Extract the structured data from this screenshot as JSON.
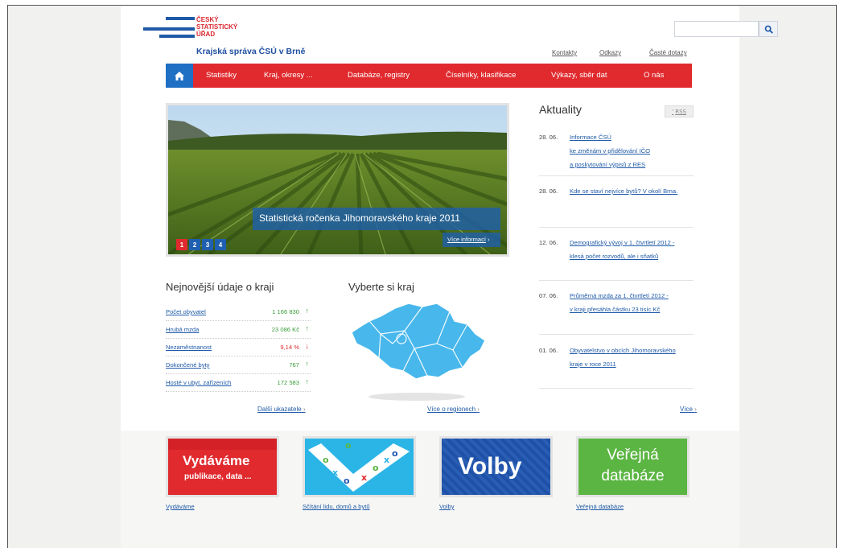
{
  "header": {
    "logo_lines": [
      "ČESKÝ",
      "STATISTICKÝ",
      "ÚŘAD"
    ],
    "subtitle": "Krajská správa ČSÚ v Brně",
    "top_links": [
      "Kontakty",
      "Odkazy",
      "Časté dotazy"
    ]
  },
  "nav": {
    "items": [
      "Statistiky",
      "Kraj, okresy ...",
      "Databáze, registry",
      "Číselníky, klasifikace",
      "Výkazy, sběr dat",
      "O nás"
    ]
  },
  "slider": {
    "caption": "Statistická ročenka Jihomoravského kraje 2011",
    "more_label": "Více informací",
    "pages": [
      "1",
      "2",
      "3",
      "4"
    ],
    "active_page": "1"
  },
  "news": {
    "title": "Aktuality",
    "rss_label": "RSS",
    "items": [
      {
        "date": "28. 06.",
        "text": "Informace ČSÚ\nke změnám v přidělování IČO\na poskytování výpisů z RES"
      },
      {
        "date": "28. 06.",
        "text": "Kde se staví nejvíce bytů? V okolí Brna."
      },
      {
        "date": "12. 06.",
        "text": "Demografický vývoj v 1. čtvrtletí 2012 -\nklesá počet rozvodů, ale i sňatků"
      },
      {
        "date": "07. 06.",
        "text": "Průměrná mzda za 1. čtvrtletí 2012 -\nv kraji přesáhla částku 23 tisíc Kč"
      },
      {
        "date": "01. 06.",
        "text": "Obyvatelstvo v obcích Jihomoravského\nkraje v roce 2011"
      }
    ],
    "more_label": "Více"
  },
  "indicators": {
    "title": "Nejnovější údaje o kraji",
    "rows": [
      {
        "label": "Počet obyvatel",
        "value": "1 166 830",
        "trend": "up"
      },
      {
        "label": "Hrubá mzda",
        "value": "23 086 Kč",
        "trend": "up"
      },
      {
        "label": "Nezaměstnanost",
        "value": "9,14 %",
        "trend": "down"
      },
      {
        "label": "Dokončené byty",
        "value": "767",
        "trend": "up"
      },
      {
        "label": "Hosté v ubyt. zařízeních",
        "value": "172 583",
        "trend": "up"
      }
    ],
    "more_label": "Další ukazatele"
  },
  "region": {
    "title": "Vyberte si kraj",
    "more_label": "Více o regionech"
  },
  "banners": [
    {
      "title": "Vydáváme",
      "subtitle": "publikace, data ...",
      "label": "Vydáváme",
      "color": "#e02a2e"
    },
    {
      "title": "",
      "subtitle": "",
      "label": "Sčítání lidu, domů a bytů",
      "color": "#2bb5e6"
    },
    {
      "title": "Volby",
      "subtitle": "",
      "label": "Volby",
      "color": "#1f55b0"
    },
    {
      "title": "Veřejná",
      "subtitle": "databáze",
      "label": "Veřejná databáze",
      "color": "#5bb543"
    }
  ],
  "colors": {
    "brand_red": "#e02a2e",
    "brand_blue": "#1f5aa8",
    "up": "#3a9b3a",
    "down": "#e02a2e"
  }
}
